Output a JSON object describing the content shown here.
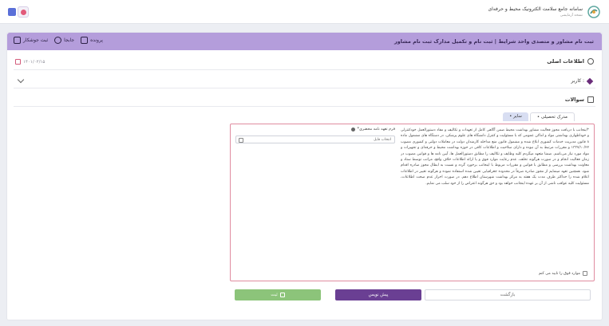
{
  "topbar": {
    "brand_title": "سامانه جامع سلامت الکترونیک محیط و حرفه‌ای",
    "brand_sub": "نسخه آزمایشی"
  },
  "header": {
    "title": "ثبت نام مشاور و متصدی واحد شرایط | ثبت نام و تکمیل مدارک ثبت نام مشاور",
    "actions": [
      {
        "label": "پرونده",
        "icon": "folder-icon"
      },
      {
        "label": "جابجا",
        "icon": "swap-icon"
      },
      {
        "label": "ثبت جوشکار",
        "icon": "register-icon"
      }
    ]
  },
  "info_section": {
    "title": "اطلاعات اصلی",
    "date": "۱۴۰۱/۰۲/۱۵"
  },
  "role": {
    "label": "کاربر :"
  },
  "questions": {
    "title": "سوالات"
  },
  "tabs": [
    {
      "label": "• مدرک تحصیلی",
      "active": true
    },
    {
      "label": "• سایر",
      "active": false
    }
  ],
  "terms": {
    "text": "*اینجانب با دریافت مجوز فعالیت مشاور بهداشت محیط ضمن آگاهی کامل از تعهدات و تکالیف و مفاد دستورالعمل خودکنترلی و خوداظهاری بهداشتی مواد و اماکن عمومی که با مسئولیت و کنترل دانشگاه های علوم پزشکی، در دستگاه های مشمول ماده ۸ قانون مدیریت خدمات کشوری ابلاغ شده و مشمول قانون منع مداخله کارمندان دولت در معاملات دولتی و کشوری مصوب ۱۳۳۷/۱۰/۲۲ و مقررات مرتبط به آن نبوده و دارای صلاحیت و اطلاعات کافی در حوزه بهداشت محیط و حرفه‌ای و تجهیزات و مواد مورد نیاز می‌باشم. ضمنا متعهد میگردم کلیه وظایف و تکالیف را مطابق دستورالعمل ها، آیین نامه ها و قوانین مصوب در زمان فعالیت انجام و در صورت هرگونه تخلف، عدم رعایت موارد فوق و یا ارائه اطلاعات خلاف واقع، مراتب توسط ستاد و معاونت بهداشت بررسی و مطابق با قوانین و مقررات مربوط با اینجانب برخورد گردد و نسبت به ابطال مجوز صادره اقدام شود. همچنین تعهد مینمایم از مجوز صادره صرفاً در محدوده جغرافیایی تعیین شده استفاده نموده و هرگونه تغییر در اطلاعات اعلام شده را حداکثر ظرف مدت یک هفته به مرکز بهداشت شهرستان اطلاع دهم. در صورت احراز عدم صحت اطلاعات، مسئولیت کلیه عواقب ناشی از آن بر عهده اینجانب خواهد بود و حق هرگونه اعتراض را از خود سلب می نمایم.",
    "doc_label": "*فرم تعهد نامه محضری",
    "file_placeholder": "انتخاب فایل",
    "agree_label": "موارد فوق را تایید می کنم"
  },
  "footer": {
    "back_label": "بازگشت",
    "draft_label": "پیش نویس",
    "submit_label": "ثبت"
  }
}
